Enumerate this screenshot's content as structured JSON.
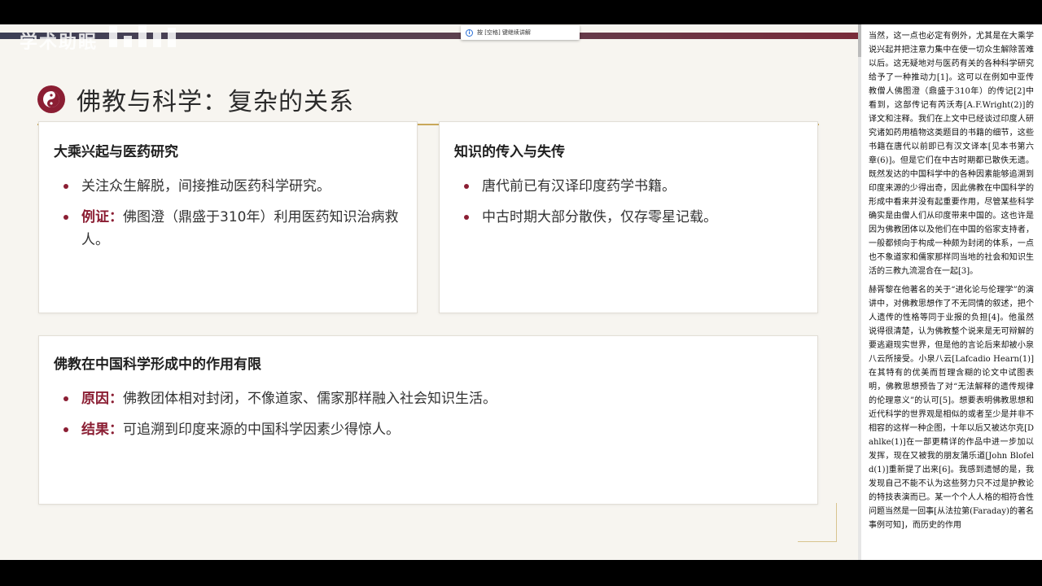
{
  "watermark": {
    "text": "学术助眠"
  },
  "toast": {
    "text": "按 [空格] 键继续讲解"
  },
  "slide": {
    "title": "佛教与科学：复杂的关系",
    "cards": [
      {
        "title": "大乘兴起与医药研究",
        "items": [
          {
            "lead": "",
            "text": "关注众生解脱，间接推动医药科学研究。"
          },
          {
            "lead": "例证：",
            "text": "佛图澄（鼎盛于310年）利用医药知识治病救人。"
          }
        ]
      },
      {
        "title": "知识的传入与失传",
        "items": [
          {
            "lead": "",
            "text": "唐代前已有汉译印度药学书籍。"
          },
          {
            "lead": "",
            "text": "中古时期大部分散佚，仅存零星记载。"
          }
        ]
      },
      {
        "title": "佛教在中国科学形成中的作用有限",
        "items": [
          {
            "lead": "原因：",
            "text": "佛教团体相对封闭，不像道家、儒家那样融入社会知识生活。"
          },
          {
            "lead": "结果：",
            "text": "可追溯到印度来源的中国科学因素少得惊人。"
          }
        ]
      }
    ]
  },
  "reader": {
    "paragraphs": [
      "当然，这一点也必定有例外，尤其是在大乘学说兴起并把注意力集中在使一切众生解除苦难以后。这无疑地对与医药有关的各种科学研究给予了一种推动力[1]。这可以在例如中亚传教僧人佛图澄（鼎盛于310年）的传记[2]中看到，这部传记有芮沃寿[A.F.Wright(2)]的译文和注释。我们在上文中已经谈过印度人研究诸如药用植物这类题目的书籍的细节，这些书籍在唐代以前即已有汉文译本[见本书第六章(6)]。但是它们在中古时期都已散佚无遗。既然发达的中国科学中的各种因素能够追溯到印度来源的少得出奇，因此佛教在中国科学的形成中看来并没有起重要作用，尽管某些科学确实是由僧人们从印度带来中国的。这也许是因为佛教团体以及他们在中国的俗家支持者，一般都倾向于构成一种颇为封闭的体系，一点也不象道家和儒家那样同当地的社会和知识生活的三教九流混合在一起[3]。",
      "赫胥黎在他著名的关于“进化论与伦理学”的演讲中，对佛教思想作了不无同情的叙述，把个人遗传的性格等同于业报的负担[4]。他虽然说得很清楚，认为佛教整个说来是无可辩解的要逃避现实世界，但是他的言论后来却被小泉八云所接受。小泉八云[Lafcadio Hearn(1)]在其特有的优美而哲理含糊的论文中试图表明，佛教思想预告了对“无法解释的遗传规律的伦理意义”的认可[5]。想要表明佛教思想和近代科学的世界观是相似的或者至少是并非不相容的这样一种企图，十年以后又被达尔克[Dahlke(1)]在一部更精详的作品中进一步加以发挥，现在又被我的朋友蒲乐道[John Blofeld(1)]重新提了出来[6]。我感到遗憾的是，我发现自己不能不认为这些努力只不过是护教论的特技表演而已。某一个个人人格的相符合性问题当然是一回事[从法拉第(Faraday)的著名事例可知]，而历史的作用"
    ]
  },
  "colors": {
    "accent": "#8b1e33",
    "gold": "#c9a85a",
    "slide_bg": "#f7f5f0"
  }
}
